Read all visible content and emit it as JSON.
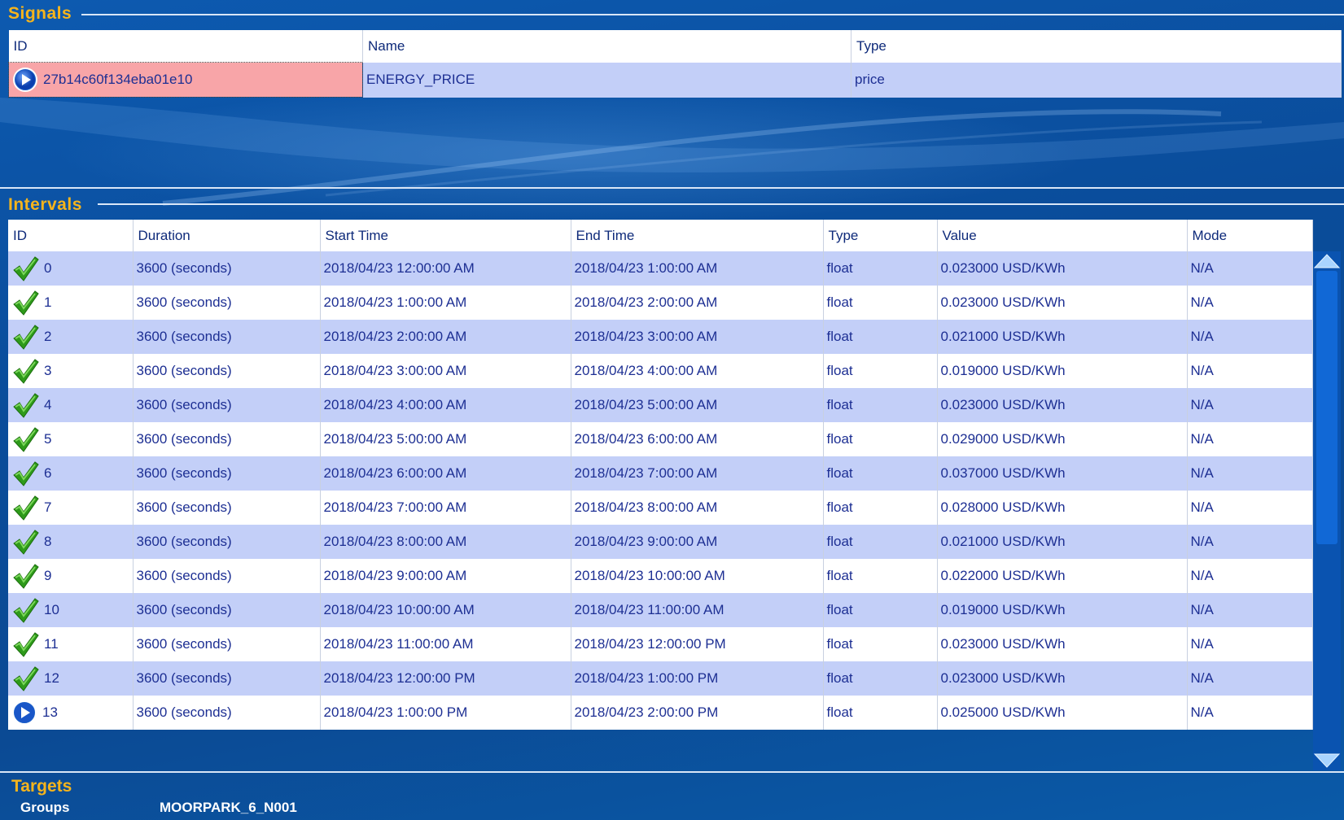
{
  "signals": {
    "title": "Signals",
    "columns": [
      "ID",
      "Name",
      "Type"
    ],
    "rows": [
      {
        "id": "27b14c60f134eba01e10",
        "name": "ENERGY_PRICE",
        "type": "price",
        "icon": "play-icon"
      }
    ]
  },
  "intervals": {
    "title": "Intervals",
    "columns": [
      "ID",
      "Duration",
      "Start Time",
      "End Time",
      "Type",
      "Value",
      "Mode"
    ],
    "rows": [
      {
        "id": "0",
        "duration": "3600 (seconds)",
        "start": "2018/04/23 12:00:00 AM",
        "end": "2018/04/23  1:00:00 AM",
        "type": "float",
        "value": "0.023000 USD/KWh",
        "mode": "N/A",
        "icon": "check-icon"
      },
      {
        "id": "1",
        "duration": "3600 (seconds)",
        "start": "2018/04/23  1:00:00 AM",
        "end": "2018/04/23  2:00:00 AM",
        "type": "float",
        "value": "0.023000 USD/KWh",
        "mode": "N/A",
        "icon": "check-icon"
      },
      {
        "id": "2",
        "duration": "3600 (seconds)",
        "start": "2018/04/23  2:00:00 AM",
        "end": "2018/04/23  3:00:00 AM",
        "type": "float",
        "value": "0.021000 USD/KWh",
        "mode": "N/A",
        "icon": "check-icon"
      },
      {
        "id": "3",
        "duration": "3600 (seconds)",
        "start": "2018/04/23  3:00:00 AM",
        "end": "2018/04/23  4:00:00 AM",
        "type": "float",
        "value": "0.019000 USD/KWh",
        "mode": "N/A",
        "icon": "check-icon"
      },
      {
        "id": "4",
        "duration": "3600 (seconds)",
        "start": "2018/04/23  4:00:00 AM",
        "end": "2018/04/23  5:00:00 AM",
        "type": "float",
        "value": "0.023000 USD/KWh",
        "mode": "N/A",
        "icon": "check-icon"
      },
      {
        "id": "5",
        "duration": "3600 (seconds)",
        "start": "2018/04/23  5:00:00 AM",
        "end": "2018/04/23  6:00:00 AM",
        "type": "float",
        "value": "0.029000 USD/KWh",
        "mode": "N/A",
        "icon": "check-icon"
      },
      {
        "id": "6",
        "duration": "3600 (seconds)",
        "start": "2018/04/23  6:00:00 AM",
        "end": "2018/04/23  7:00:00 AM",
        "type": "float",
        "value": "0.037000 USD/KWh",
        "mode": "N/A",
        "icon": "check-icon"
      },
      {
        "id": "7",
        "duration": "3600 (seconds)",
        "start": "2018/04/23  7:00:00 AM",
        "end": "2018/04/23  8:00:00 AM",
        "type": "float",
        "value": "0.028000 USD/KWh",
        "mode": "N/A",
        "icon": "check-icon"
      },
      {
        "id": "8",
        "duration": "3600 (seconds)",
        "start": "2018/04/23  8:00:00 AM",
        "end": "2018/04/23  9:00:00 AM",
        "type": "float",
        "value": "0.021000 USD/KWh",
        "mode": "N/A",
        "icon": "check-icon"
      },
      {
        "id": "9",
        "duration": "3600 (seconds)",
        "start": "2018/04/23  9:00:00 AM",
        "end": "2018/04/23 10:00:00 AM",
        "type": "float",
        "value": "0.022000 USD/KWh",
        "mode": "N/A",
        "icon": "check-icon"
      },
      {
        "id": "10",
        "duration": "3600 (seconds)",
        "start": "2018/04/23 10:00:00 AM",
        "end": "2018/04/23 11:00:00 AM",
        "type": "float",
        "value": "0.019000 USD/KWh",
        "mode": "N/A",
        "icon": "check-icon"
      },
      {
        "id": "11",
        "duration": "3600 (seconds)",
        "start": "2018/04/23 11:00:00 AM",
        "end": "2018/04/23 12:00:00 PM",
        "type": "float",
        "value": "0.023000 USD/KWh",
        "mode": "N/A",
        "icon": "check-icon"
      },
      {
        "id": "12",
        "duration": "3600 (seconds)",
        "start": "2018/04/23 12:00:00 PM",
        "end": "2018/04/23  1:00:00 PM",
        "type": "float",
        "value": "0.023000 USD/KWh",
        "mode": "N/A",
        "icon": "check-icon"
      },
      {
        "id": "13",
        "duration": "3600 (seconds)",
        "start": "2018/04/23  1:00:00 PM",
        "end": "2018/04/23  2:00:00 PM",
        "type": "float",
        "value": "0.025000 USD/KWh",
        "mode": "N/A",
        "icon": "play-icon"
      }
    ]
  },
  "targets": {
    "title": "Targets",
    "groups_label": "Groups",
    "groups_value": "MOORPARK_6_N001"
  },
  "colors": {
    "section_title": "#f6b41c",
    "row_alt": "#c3cff8",
    "selected_cell": "#f8a5a8",
    "text": "#1d2f93"
  }
}
